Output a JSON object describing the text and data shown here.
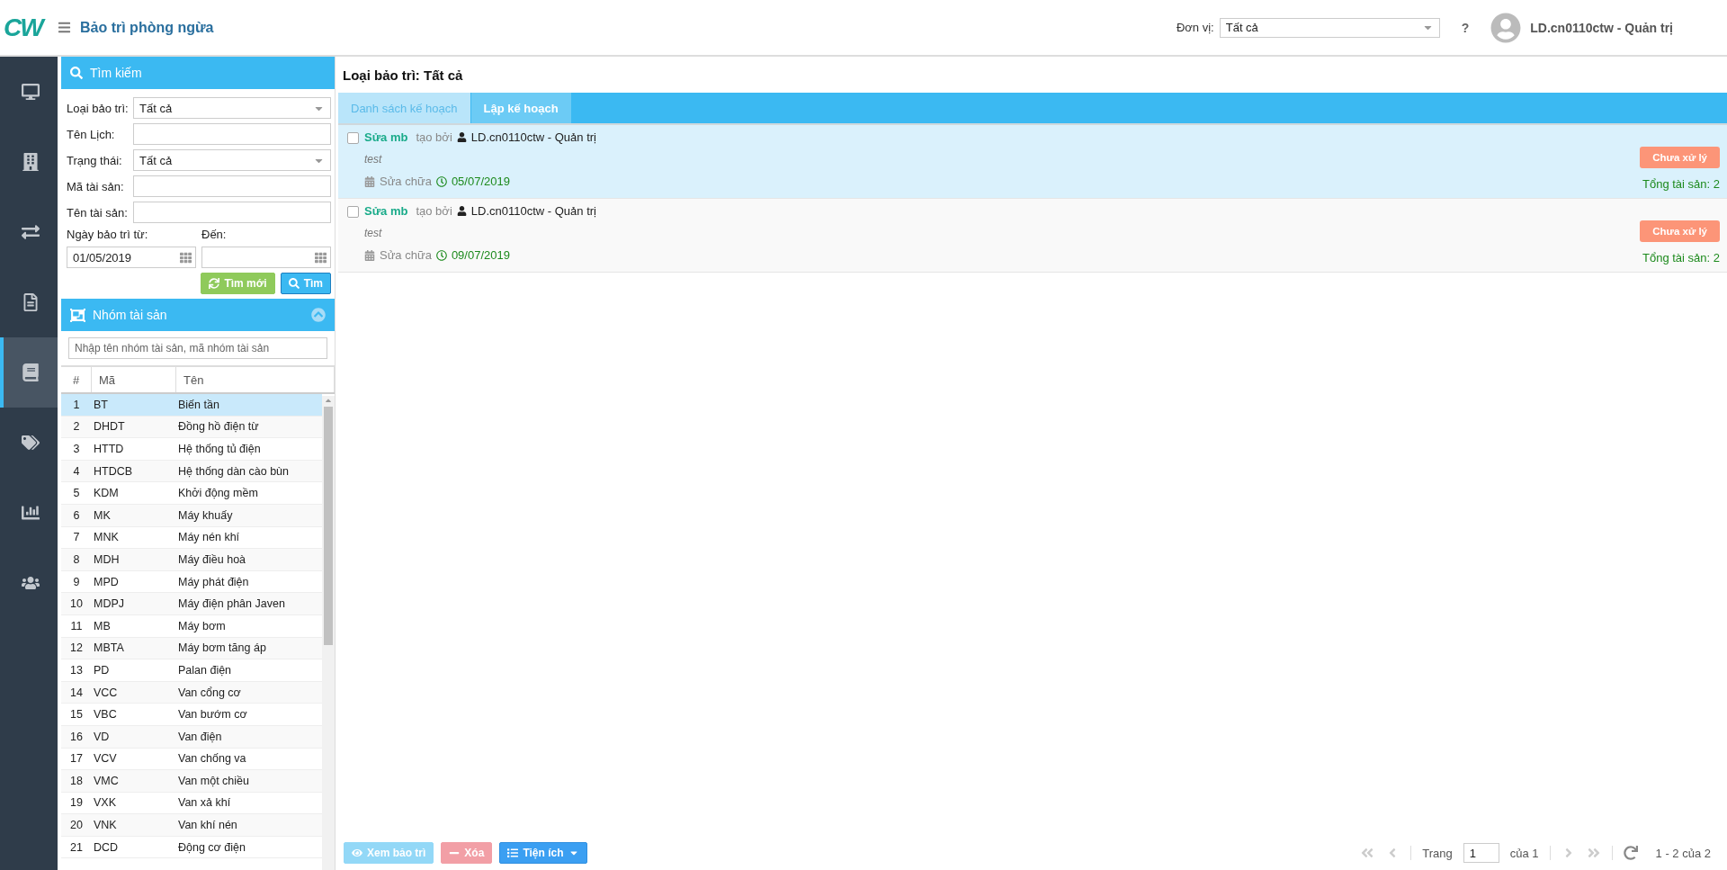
{
  "header": {
    "logo": "CW",
    "title": "Bảo trì phòng ngừa",
    "unit_label": "Đơn vị:",
    "unit_value": "Tất cả",
    "help": "?",
    "user": "LD.cn0110ctw - Quản trị"
  },
  "nav": [
    {
      "kind": "monitor",
      "selected": false
    },
    {
      "kind": "building",
      "selected": false
    },
    {
      "kind": "exchange",
      "selected": false
    },
    {
      "kind": "document",
      "selected": false
    },
    {
      "kind": "book",
      "selected": true
    },
    {
      "kind": "tags",
      "selected": false
    },
    {
      "kind": "chart",
      "selected": false
    },
    {
      "kind": "users",
      "selected": false
    }
  ],
  "search": {
    "title": "Tìm kiếm",
    "fields": [
      {
        "label": "Loại bảo trì:",
        "kind": "select",
        "value": "Tất cả"
      },
      {
        "label": "Tên Lịch:",
        "kind": "text"
      },
      {
        "label": "Trạng thái:",
        "kind": "select",
        "value": "Tất cả"
      },
      {
        "label": "Mã tài sản:",
        "kind": "text"
      },
      {
        "label": "Tên tài sản:",
        "kind": "text"
      }
    ],
    "date_from_label": "Ngày bảo trì từ:",
    "date_from": "01/05/2019",
    "date_to_label": "Đến:",
    "reset_button": "Tìm mới",
    "search_button": "Tìm"
  },
  "groups": {
    "title": "Nhóm tài sản",
    "placeholder": "Nhập tên nhóm tài sản, mã nhóm tài sản",
    "columns": [
      "#",
      "Mã",
      "Tên"
    ],
    "rows": [
      {
        "index": "1",
        "code": "BT",
        "name": "Biến tần",
        "selected": true
      },
      {
        "index": "2",
        "code": "DHDT",
        "name": "Đồng hồ điện từ",
        "selected": false
      },
      {
        "index": "3",
        "code": "HTTD",
        "name": "Hệ thống tủ điện",
        "selected": false
      },
      {
        "index": "4",
        "code": "HTDCB",
        "name": "Hệ thống dàn cào bùn",
        "selected": false
      },
      {
        "index": "5",
        "code": "KDM",
        "name": "Khởi động mềm",
        "selected": false
      },
      {
        "index": "6",
        "code": "MK",
        "name": "Máy khuấy",
        "selected": false
      },
      {
        "index": "7",
        "code": "MNK",
        "name": "Máy nén khí",
        "selected": false
      },
      {
        "index": "8",
        "code": "MDH",
        "name": "Máy điều hoà",
        "selected": false
      },
      {
        "index": "9",
        "code": "MPD",
        "name": "Máy phát điện",
        "selected": false
      },
      {
        "index": "10",
        "code": "MDPJ",
        "name": "Máy điện phân Javen",
        "selected": false
      },
      {
        "index": "11",
        "code": "MB",
        "name": "Máy bơm",
        "selected": false
      },
      {
        "index": "12",
        "code": "MBTA",
        "name": "Máy bơm tăng áp",
        "selected": false
      },
      {
        "index": "13",
        "code": "PD",
        "name": "Palan điện",
        "selected": false
      },
      {
        "index": "14",
        "code": "VCC",
        "name": "Van cổng cơ",
        "selected": false
      },
      {
        "index": "15",
        "code": "VBC",
        "name": "Van bướm cơ",
        "selected": false
      },
      {
        "index": "16",
        "code": "VD",
        "name": "Van điện",
        "selected": false
      },
      {
        "index": "17",
        "code": "VCV",
        "name": "Van chống va",
        "selected": false
      },
      {
        "index": "18",
        "code": "VMC",
        "name": "Van một chiều",
        "selected": false
      },
      {
        "index": "19",
        "code": "VXK",
        "name": "Van xả khí",
        "selected": false
      },
      {
        "index": "20",
        "code": "VNK",
        "name": "Van khí nén",
        "selected": false
      },
      {
        "index": "21",
        "code": "DCD",
        "name": "Động cơ điện",
        "selected": false
      }
    ]
  },
  "main": {
    "heading": "Loại bảo trì: Tất cả",
    "tabs": [
      {
        "label": "Danh sách kế hoạch",
        "selected": true
      },
      {
        "label": "Lập kế hoạch",
        "selected": false
      }
    ],
    "plans": [
      {
        "title": "Sửa mb",
        "by_label": "tạo bởi",
        "user": "LD.cn0110ctw - Quản trị",
        "note": "test",
        "type": "Sửa chữa",
        "date": "05/07/2019",
        "status": "Chưa xử lý",
        "total": "Tổng tài sản: 2",
        "selected": true,
        "checked": false
      },
      {
        "title": "Sửa mb",
        "by_label": "tạo bởi",
        "user": "LD.cn0110ctw - Quản trị",
        "note": "test",
        "type": "Sửa chữa",
        "date": "09/07/2019",
        "status": "Chưa xử lý",
        "total": "Tổng tài sản: 2",
        "selected": false,
        "checked": false
      }
    ]
  },
  "footer": {
    "buttons": [
      {
        "kind": "view",
        "label": "Xem bảo trì",
        "disabled": true
      },
      {
        "kind": "delete",
        "label": "Xóa",
        "disabled": true
      },
      {
        "kind": "utilities",
        "label": "Tiện ích",
        "disabled": false
      }
    ],
    "page_label": "Trang",
    "page": "1",
    "page_of": "của 1",
    "summary": "1 - 2 của 2"
  }
}
